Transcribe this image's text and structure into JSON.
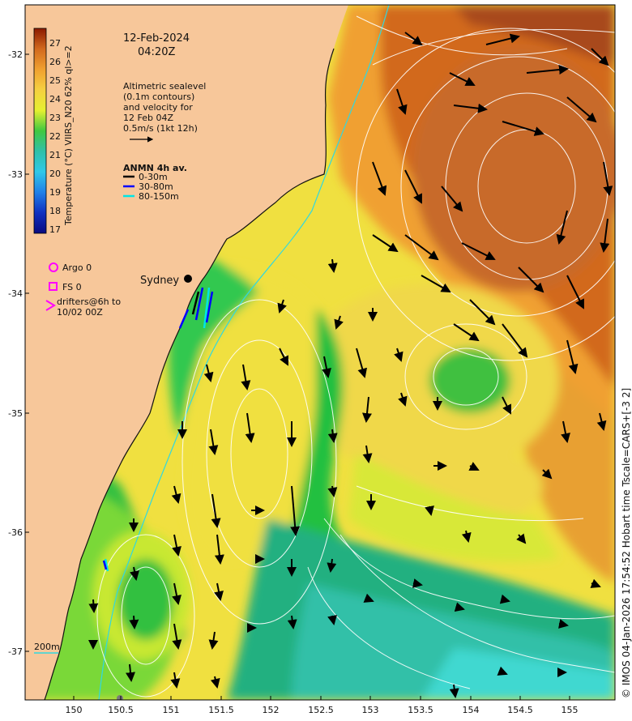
{
  "date_line": "12-Feb-2024",
  "time_line": "04:20Z",
  "description_lines": [
    "Altimetric sealevel",
    "(0.1m contours)",
    "and velocity for",
    "12 Feb 04Z",
    "0.5m/s (1kt 12h)"
  ],
  "anmn": {
    "title": "ANMN 4h av.",
    "items": [
      {
        "label": "0-30m",
        "color": "#000000"
      },
      {
        "label": "30-80m",
        "color": "#0000ff"
      },
      {
        "label": "80-150m",
        "color": "#00e5e5"
      }
    ]
  },
  "colorbar": {
    "label": "Temperature (°C) VIIRS_N20 62% ql>=2",
    "ticks": [
      "27",
      "26",
      "25",
      "24",
      "23",
      "22",
      "21",
      "20",
      "19",
      "18",
      "17"
    ]
  },
  "legend": {
    "argo": "Argo 0",
    "fs": "FS 0",
    "drifters_line1": "drifters@6h to",
    "drifters_line2": "10/02 00Z",
    "argo_color": "#ff00ff"
  },
  "place": "Sydney",
  "depth_label": "200m",
  "y_ticks": [
    "-32",
    "-33",
    "-34",
    "-35",
    "-36",
    "-37"
  ],
  "x_ticks": [
    "150",
    "150.5",
    "151",
    "151.5",
    "152",
    "152.5",
    "153",
    "153.5",
    "154",
    "154.5",
    "155"
  ],
  "credit": "© IMOS 04-Jan-2026 17:54:52 Hobart time Tscale=CARS+[-3 2]",
  "colors": {
    "land": "#f7c79a",
    "warm": "#d2691e",
    "orange": "#f0a030",
    "yellow": "#f0e040",
    "lime": "#b8e830",
    "green": "#20c040",
    "teal": "#30c0a8",
    "cyan": "#40d8d0"
  }
}
